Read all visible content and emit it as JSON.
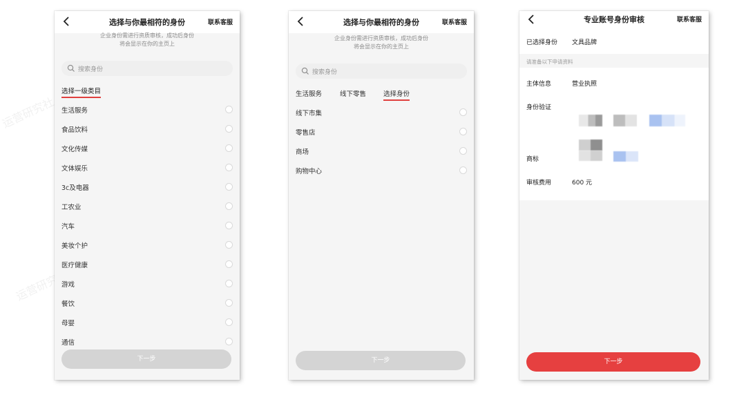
{
  "screen1": {
    "title": "选择与你最相符的身份",
    "service": "联系客服",
    "subtitle_line1": "企业身份需进行资质审核，成功后身份",
    "subtitle_line2": "将会显示在你的主页上",
    "search_placeholder": "搜索身份",
    "section_title": "选择一级类目",
    "categories": [
      "生活服务",
      "食品饮料",
      "文化传媒",
      "文体娱乐",
      "3c及电器",
      "工农业",
      "汽车",
      "美妆个护",
      "医疗健康",
      "游戏",
      "餐饮",
      "母婴",
      "通信"
    ],
    "next_label": "下一步"
  },
  "screen2": {
    "title": "选择与你最相符的身份",
    "service": "联系客服",
    "subtitle_line1": "企业身份需进行资质审核，成功后身份",
    "subtitle_line2": "将会显示在你的主页上",
    "search_placeholder": "搜索身份",
    "tabs": [
      "生活服务",
      "线下零售",
      "选择身份"
    ],
    "options": [
      "线下市集",
      "零售店",
      "商场",
      "购物中心"
    ],
    "next_label": "下一步"
  },
  "screen3": {
    "title": "专业账号身份审核",
    "service": "联系客服",
    "selected_label": "已选择身份",
    "selected_value": "文具品牌",
    "hint": "请准备以下申请资料",
    "subject_label": "主体信息",
    "subject_value": "营业执照",
    "verify_label": "身份验证",
    "trademark_label": "商标",
    "fee_label": "审核费用",
    "fee_value": "600 元",
    "next_label": "下一步"
  },
  "colors": {
    "accent": "#e64040",
    "underline": "#e0403e",
    "disabled": "#d4d4d4",
    "panel_bg": "#f5f5f5"
  }
}
